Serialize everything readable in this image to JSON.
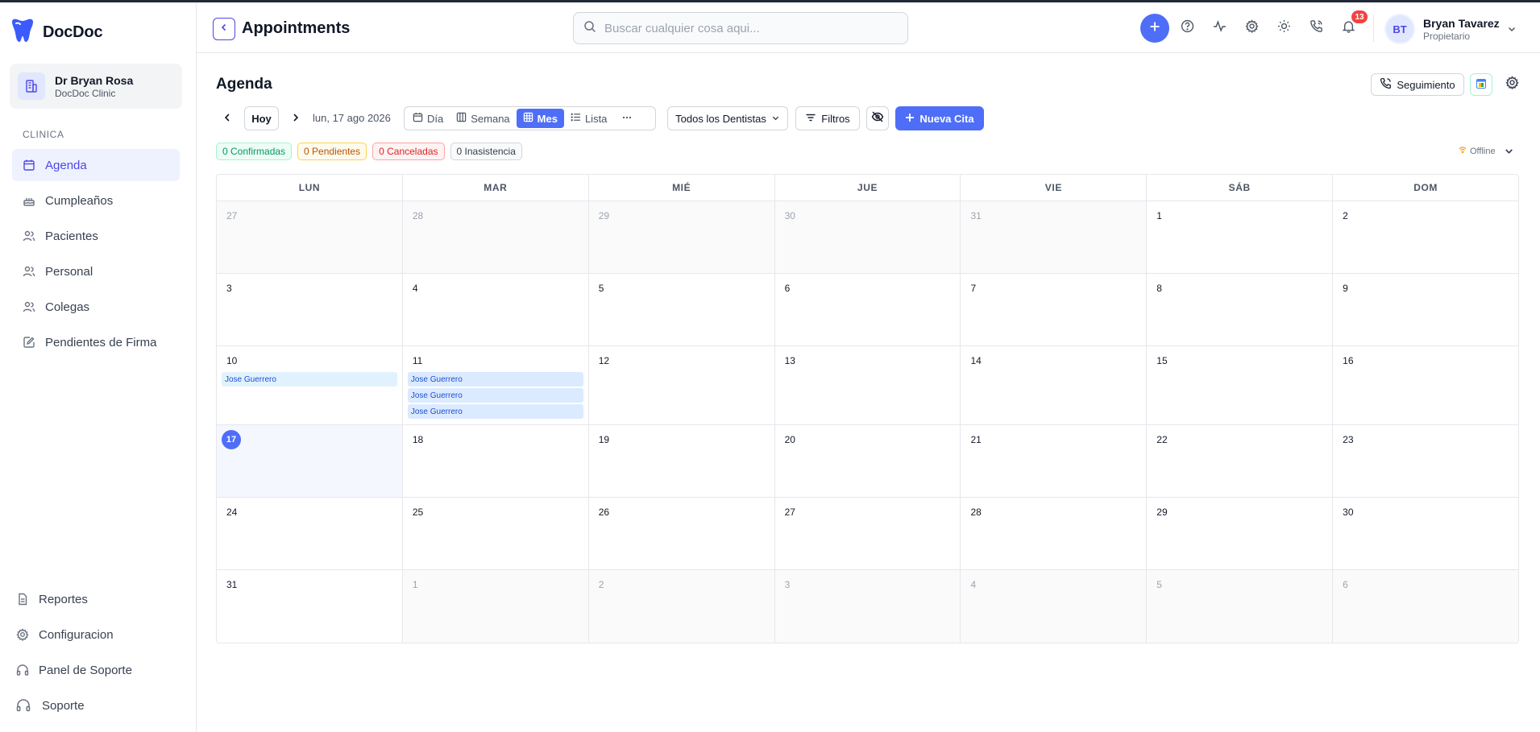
{
  "brand": {
    "name": "DocDoc",
    "color": "#3b5bfd"
  },
  "clinic": {
    "name": "Dr Bryan Rosa",
    "subtitle": "DocDoc Clinic"
  },
  "sidebar": {
    "section_label": "CLINICA",
    "items": [
      {
        "label": "Agenda",
        "icon": "calendar-icon",
        "active": true
      },
      {
        "label": "Cumpleaños",
        "icon": "cake-icon",
        "active": false
      },
      {
        "label": "Pacientes",
        "icon": "users-icon",
        "active": false
      },
      {
        "label": "Personal",
        "icon": "users-icon",
        "active": false
      },
      {
        "label": "Colegas",
        "icon": "users-icon",
        "active": false
      },
      {
        "label": "Pendientes de Firma",
        "icon": "signature-icon",
        "active": false
      }
    ],
    "bottom_items": [
      {
        "label": "Reportes",
        "icon": "document-icon"
      },
      {
        "label": "Configuracion",
        "icon": "gear-icon"
      },
      {
        "label": "Panel de Soporte",
        "icon": "headphones-icon"
      },
      {
        "label": "Soporte",
        "icon": "headphones-icon"
      }
    ]
  },
  "header": {
    "title": "Appointments",
    "search_placeholder": "Buscar cualquier cosa aqui...",
    "notifications_count": "13",
    "user": {
      "initials": "BT",
      "name": "Bryan Tavarez",
      "role": "Propietario"
    }
  },
  "agenda": {
    "title": "Agenda",
    "followup_label": "Seguimiento",
    "today_label": "Hoy",
    "date_label": "lun, 17 ago 2026",
    "views": [
      {
        "label": "Día",
        "icon": "calendar-day-icon",
        "active": false
      },
      {
        "label": "Semana",
        "icon": "week-columns-icon",
        "active": false
      },
      {
        "label": "Mes",
        "icon": "grid-icon",
        "active": true
      },
      {
        "label": "Lista",
        "icon": "list-icon",
        "active": false
      }
    ],
    "dentists_label": "Todos los Dentistas",
    "filters_label": "Filtros",
    "new_label": "Nueva Cita",
    "status": [
      {
        "label": "0 Confirmadas",
        "color": "#059669",
        "bg": "#ecfdf5",
        "border": "#a7f3d0"
      },
      {
        "label": "0 Pendientes",
        "color": "#b45309",
        "bg": "#fffbeb",
        "border": "#fcd34d"
      },
      {
        "label": "0 Canceladas",
        "color": "#dc2626",
        "bg": "#fef2f2",
        "border": "#fca5a5"
      },
      {
        "label": "0 Inasistencia",
        "color": "#374151",
        "bg": "#f9fafb",
        "border": "#d1d5db"
      }
    ],
    "connection": "Offline"
  },
  "calendar": {
    "weekdays": [
      "LUN",
      "MAR",
      "MIÉ",
      "JUE",
      "VIE",
      "SÁB",
      "DOM"
    ],
    "weeks": [
      [
        {
          "d": "27",
          "muted": true
        },
        {
          "d": "28",
          "muted": true
        },
        {
          "d": "29",
          "muted": true
        },
        {
          "d": "30",
          "muted": true
        },
        {
          "d": "31",
          "muted": true
        },
        {
          "d": "1"
        },
        {
          "d": "2"
        }
      ],
      [
        {
          "d": "3"
        },
        {
          "d": "4"
        },
        {
          "d": "5"
        },
        {
          "d": "6"
        },
        {
          "d": "7"
        },
        {
          "d": "8"
        },
        {
          "d": "9"
        }
      ],
      [
        {
          "d": "10",
          "events": [
            "Jose Guerrero"
          ]
        },
        {
          "d": "11",
          "events": [
            "Jose Guerrero",
            "Jose Guerrero",
            "Jose Guerrero"
          ]
        },
        {
          "d": "12"
        },
        {
          "d": "13"
        },
        {
          "d": "14"
        },
        {
          "d": "15"
        },
        {
          "d": "16"
        }
      ],
      [
        {
          "d": "17",
          "today": true
        },
        {
          "d": "18"
        },
        {
          "d": "19"
        },
        {
          "d": "20"
        },
        {
          "d": "21"
        },
        {
          "d": "22"
        },
        {
          "d": "23"
        }
      ],
      [
        {
          "d": "24"
        },
        {
          "d": "25"
        },
        {
          "d": "26"
        },
        {
          "d": "27"
        },
        {
          "d": "28"
        },
        {
          "d": "29"
        },
        {
          "d": "30"
        }
      ],
      [
        {
          "d": "31"
        },
        {
          "d": "1",
          "muted": true
        },
        {
          "d": "2",
          "muted": true
        },
        {
          "d": "3",
          "muted": true
        },
        {
          "d": "4",
          "muted": true
        },
        {
          "d": "5",
          "muted": true
        },
        {
          "d": "6",
          "muted": true
        }
      ]
    ]
  }
}
